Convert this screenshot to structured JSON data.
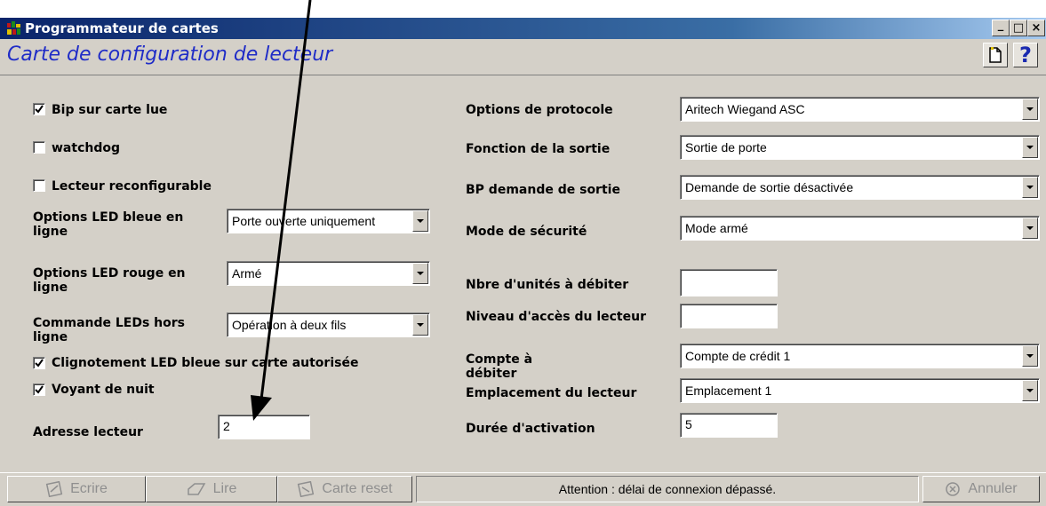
{
  "window": {
    "title": "Programmateur de cartes",
    "subtitle": "Carte de configuration de lecteur",
    "caption_buttons": {
      "minimize": "_",
      "maximize": "□",
      "close": "×"
    }
  },
  "header": {
    "new_icon": "document-icon",
    "help_icon": "question-icon",
    "help_label": "?"
  },
  "left": {
    "bip": {
      "label": "Bip sur carte lue",
      "checked": true
    },
    "watchdog": {
      "label": "watchdog",
      "checked": false
    },
    "reconfig": {
      "label": "Lecteur reconfigurable",
      "checked": false
    },
    "led_bleue": {
      "label": "Options LED bleue en ligne",
      "value": "Porte ouverte uniquement"
    },
    "led_rouge": {
      "label": "Options LED rouge en ligne",
      "value": "Armé"
    },
    "cmd_leds": {
      "label": "Commande LEDs hors ligne",
      "value": "Opération à deux fils"
    },
    "clignotement": {
      "label": "Clignotement LED bleue sur carte autorisée",
      "checked": true
    },
    "voyant_nuit": {
      "label": "Voyant de nuit",
      "checked": true
    },
    "adresse": {
      "label": "Adresse lecteur",
      "value": "2"
    }
  },
  "right": {
    "protocole": {
      "label": "Options de protocole",
      "value": "Aritech Wiegand ASC"
    },
    "fonction_sortie": {
      "label": "Fonction de la sortie",
      "value": "Sortie de porte"
    },
    "bp_demande": {
      "label": "BP demande de sortie",
      "value": "Demande de sortie désactivée"
    },
    "mode_securite": {
      "label": "Mode de sécurité",
      "value": "Mode armé"
    },
    "nbre_unites": {
      "label": "Nbre d'unités à débiter",
      "value": ""
    },
    "niveau_acces": {
      "label": "Niveau d'accès du lecteur",
      "value": ""
    },
    "compte": {
      "label": "Compte à débiter",
      "value": "Compte de crédit 1"
    },
    "emplacement": {
      "label": "Emplacement du lecteur",
      "value": "Emplacement 1"
    },
    "duree": {
      "label": "Durée d'activation",
      "value": "5"
    }
  },
  "bottom": {
    "ecrire": "Ecrire",
    "lire": "Lire",
    "carte_reset": "Carte reset",
    "status": "Attention : délai de connexion dépassé.",
    "annuler": "Annuler"
  },
  "colors": {
    "title_bar": "#0a246a",
    "subtitle": "#1f2cc7",
    "face": "#d4d0c8",
    "disabled_text": "#8f8f8f"
  }
}
